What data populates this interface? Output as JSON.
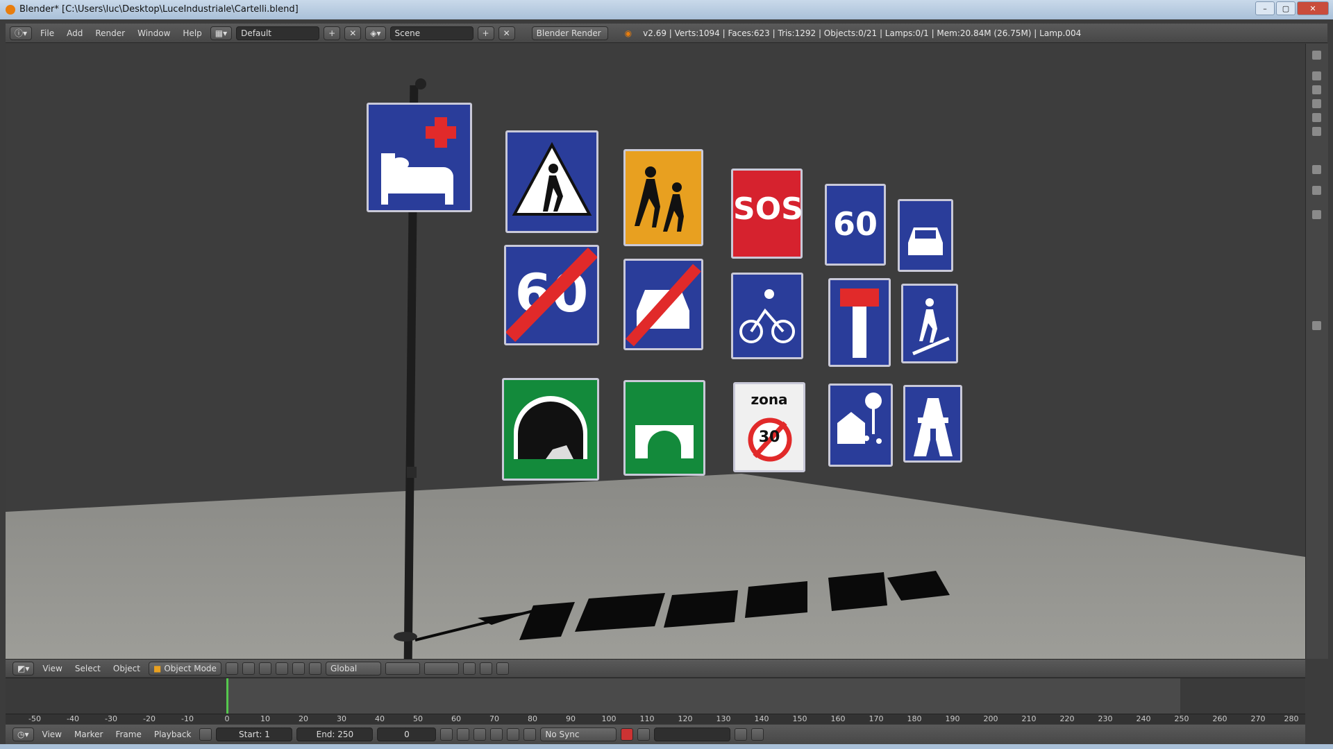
{
  "titlebar": {
    "title": "Blender* [C:\\Users\\luc\\Desktop\\LuceIndustriale\\Cartelli.blend]",
    "min": "–",
    "max": "▢",
    "close": "✕"
  },
  "header": {
    "menus": [
      "File",
      "Add",
      "Render",
      "Window",
      "Help"
    ],
    "layout": "Default",
    "scene": "Scene",
    "engine": "Blender Render",
    "info": "v2.69 | Verts:1094 | Faces:623 | Tris:1292 | Objects:0/21 | Lamps:0/1 | Mem:20.84M (26.75M) | Lamp.004"
  },
  "view3d_header": {
    "menus": [
      "View",
      "Select",
      "Object"
    ],
    "mode": "Object Mode",
    "orientation": "Global"
  },
  "timeline": {
    "ticks": [
      "-50",
      "-40",
      "-30",
      "-20",
      "-10",
      "0",
      "10",
      "20",
      "30",
      "40",
      "50",
      "60",
      "70",
      "80",
      "90",
      "100",
      "110",
      "120",
      "130",
      "140",
      "150",
      "160",
      "170",
      "180",
      "190",
      "200",
      "210",
      "220",
      "230",
      "240",
      "250",
      "260",
      "270",
      "280"
    ],
    "menus": [
      "View",
      "Marker",
      "Frame",
      "Playback"
    ],
    "start": "Start: 1",
    "end": "End: 250",
    "current": "0",
    "sync": "No Sync"
  },
  "signs": {
    "sos": "SOS",
    "sixty": "60",
    "sixty_end": "60",
    "zona": "zona",
    "thirty": "30"
  },
  "colors": {
    "accent_orange": "#e87d0d",
    "sign_blue": "#2a3d9a",
    "sign_green": "#138a3b",
    "sign_red": "#d6222e"
  },
  "icons": [
    "blender-logo-icon",
    "info-icon",
    "screen-layout-icon",
    "scene-icon",
    "render-icon",
    "view3d-icon",
    "object-mode-icon",
    "timeline-icon",
    "play-icon",
    "record-icon"
  ]
}
